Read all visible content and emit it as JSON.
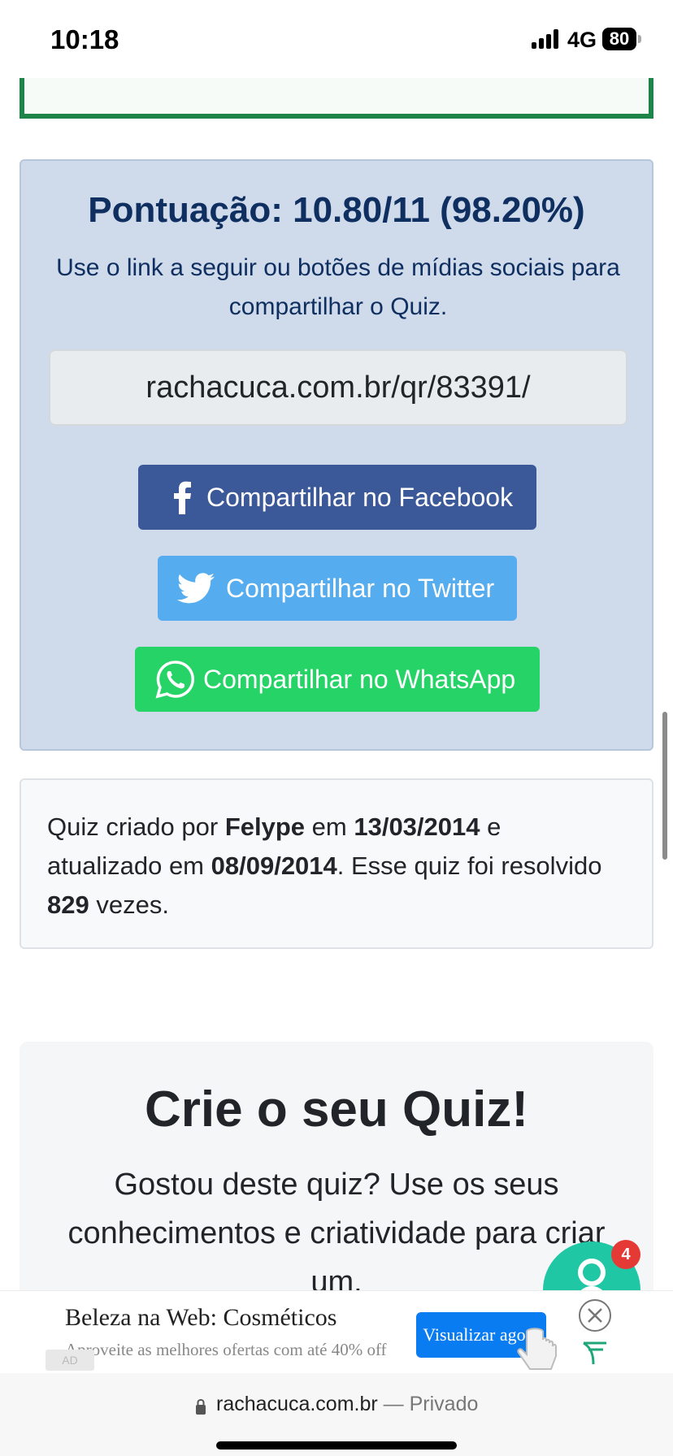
{
  "status_bar": {
    "time": "10:18",
    "network": "4G",
    "battery": "80"
  },
  "score_card": {
    "title": "Pontuação: 10.80/11 (98.20%)",
    "subtitle": "Use o link a seguir ou botões de mídias sociais para compartilhar o Quiz.",
    "share_link": "rachacuca.com.br/qr/83391/",
    "buttons": {
      "facebook": "Compartilhar no Facebook",
      "twitter": "Compartilhar no Twitter",
      "whatsapp": "Compartilhar no WhatsApp"
    },
    "colors": {
      "background": "#cfdaea",
      "facebook": "#3b5998",
      "twitter": "#55acee",
      "whatsapp": "#25d366"
    }
  },
  "quiz_info": {
    "prefix": "Quiz criado por ",
    "author": "Felype",
    "created_prefix": " em ",
    "created_date": "13/03/2014",
    "updated_prefix": " e atualizado em ",
    "updated_date": "08/09/2014",
    "solved_prefix": ". Esse quiz foi resolvido ",
    "solved_count": "829",
    "solved_suffix": " vezes."
  },
  "create_quiz": {
    "title": "Crie o seu Quiz!",
    "text": "Gostou deste quiz? Use os seus conhecimentos e criatividade para criar um."
  },
  "help_fab": {
    "badge": "4",
    "icon": "help-person-icon",
    "color": "#1fc7a5"
  },
  "ad": {
    "title": "Beleza na Web: Cosméticos",
    "description": "Aproveite as melhores ofertas com até 40% off",
    "cta": "Visualizar agora",
    "mark": "AD"
  },
  "url_bar": {
    "domain": "rachacuca.com.br",
    "separator": " — ",
    "mode": "Privado"
  }
}
